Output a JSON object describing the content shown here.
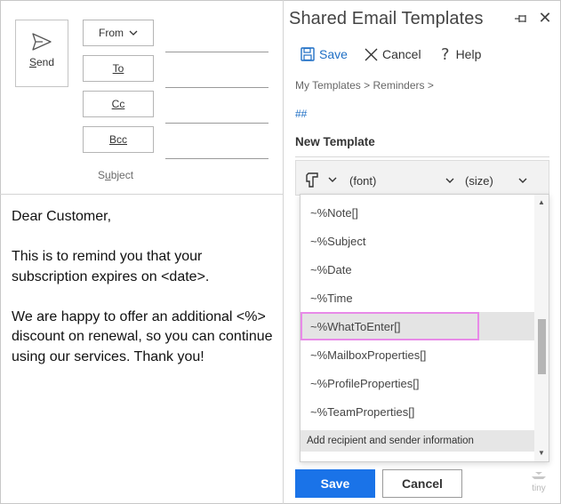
{
  "compose": {
    "send_label": "Send",
    "from_label": "From",
    "to_label": "To",
    "cc_label": "Cc",
    "bcc_label": "Bcc",
    "subject_label": "Subject",
    "body": {
      "greeting": "Dear Customer,",
      "paragraph1": "This is to remind you that your subscription expires on <date>.",
      "paragraph2": "We are happy to offer an additional <%> discount on renewal, so you can continue using our services. Thank you!"
    }
  },
  "pane": {
    "title": "Shared Email Templates",
    "toolbar": {
      "save": "Save",
      "cancel": "Cancel",
      "help": "Help"
    },
    "breadcrumb": "My Templates > Reminders >",
    "hash_link": "##",
    "template_name": "New Template",
    "editor": {
      "font_label": "(font)",
      "size_label": "(size)"
    },
    "dropdown": {
      "items": [
        "~%Note[]",
        "~%Subject",
        "~%Date",
        "~%Time",
        "~%WhatToEnter[]",
        "~%MailboxProperties[]",
        "~%ProfileProperties[]",
        "~%TeamProperties[]"
      ],
      "active_index": 4,
      "footer": "Add recipient and sender information"
    },
    "buttons": {
      "save": "Save",
      "cancel": "Cancel"
    },
    "logo_text": "tiny"
  },
  "colors": {
    "accent": "#1a73e8",
    "link": "#1f6fc5",
    "highlight_border": "#e88ae8"
  }
}
